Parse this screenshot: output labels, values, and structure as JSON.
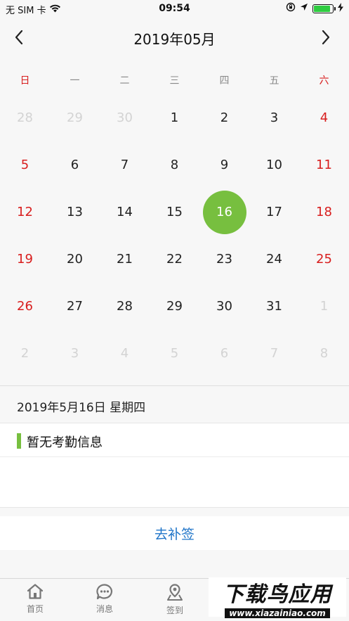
{
  "status_bar": {
    "carrier": "无 SIM 卡",
    "time": "09:54",
    "icons": [
      "wifi-icon",
      "orientation-lock-icon",
      "location-icon",
      "battery-icon",
      "charging-icon"
    ]
  },
  "header": {
    "title": "2019年05月",
    "prev_icon": "chevron-left-icon",
    "next_icon": "chevron-right-icon"
  },
  "weekdays": [
    "日",
    "一",
    "二",
    "三",
    "四",
    "五",
    "六"
  ],
  "calendar": {
    "weeks": [
      [
        {
          "d": "28",
          "t": "muted"
        },
        {
          "d": "29",
          "t": "muted"
        },
        {
          "d": "30",
          "t": "muted"
        },
        {
          "d": "1",
          "t": "normal"
        },
        {
          "d": "2",
          "t": "normal"
        },
        {
          "d": "3",
          "t": "normal"
        },
        {
          "d": "4",
          "t": "red"
        }
      ],
      [
        {
          "d": "5",
          "t": "red"
        },
        {
          "d": "6",
          "t": "normal"
        },
        {
          "d": "7",
          "t": "normal"
        },
        {
          "d": "8",
          "t": "normal"
        },
        {
          "d": "9",
          "t": "normal"
        },
        {
          "d": "10",
          "t": "normal"
        },
        {
          "d": "11",
          "t": "red"
        }
      ],
      [
        {
          "d": "12",
          "t": "red"
        },
        {
          "d": "13",
          "t": "normal"
        },
        {
          "d": "14",
          "t": "normal"
        },
        {
          "d": "15",
          "t": "normal"
        },
        {
          "d": "16",
          "t": "selected"
        },
        {
          "d": "17",
          "t": "normal"
        },
        {
          "d": "18",
          "t": "red"
        }
      ],
      [
        {
          "d": "19",
          "t": "red"
        },
        {
          "d": "20",
          "t": "normal"
        },
        {
          "d": "21",
          "t": "normal"
        },
        {
          "d": "22",
          "t": "normal"
        },
        {
          "d": "23",
          "t": "normal"
        },
        {
          "d": "24",
          "t": "normal"
        },
        {
          "d": "25",
          "t": "red"
        }
      ],
      [
        {
          "d": "26",
          "t": "red"
        },
        {
          "d": "27",
          "t": "normal"
        },
        {
          "d": "28",
          "t": "normal"
        },
        {
          "d": "29",
          "t": "normal"
        },
        {
          "d": "30",
          "t": "normal"
        },
        {
          "d": "31",
          "t": "normal"
        },
        {
          "d": "1",
          "t": "muted"
        }
      ],
      [
        {
          "d": "2",
          "t": "muted"
        },
        {
          "d": "3",
          "t": "muted"
        },
        {
          "d": "4",
          "t": "muted"
        },
        {
          "d": "5",
          "t": "muted"
        },
        {
          "d": "6",
          "t": "muted"
        },
        {
          "d": "7",
          "t": "muted"
        },
        {
          "d": "8",
          "t": "muted"
        }
      ]
    ]
  },
  "selected_date": "2019年5月16日 星期四",
  "records": {
    "empty_text": "暂无考勤信息"
  },
  "action": {
    "label": "去补签"
  },
  "tabs": [
    {
      "label": "首页",
      "icon": "home-icon"
    },
    {
      "label": "消息",
      "icon": "message-icon"
    },
    {
      "label": "签到",
      "icon": "location-pin-icon"
    }
  ],
  "watermark": {
    "main": "下载鸟应用",
    "sub": "www.xiazainiao.com"
  },
  "colors": {
    "accent_green": "#77bf3f",
    "weekend_red": "#d81e1e",
    "link_blue": "#1e74c8",
    "muted_gray": "#d3d3d3"
  }
}
